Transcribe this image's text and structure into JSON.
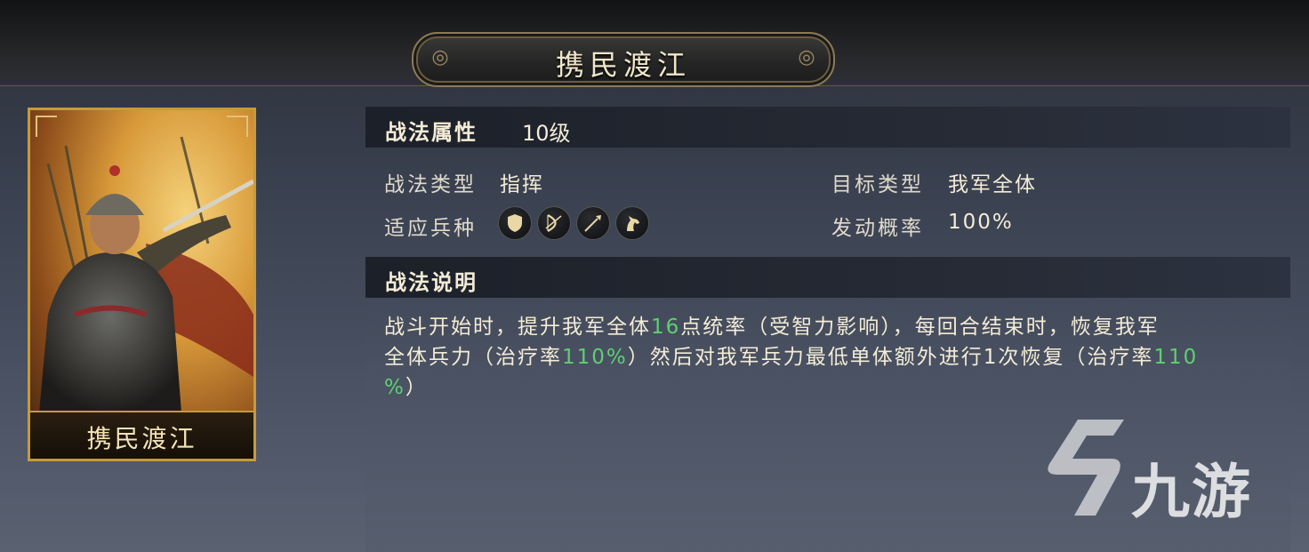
{
  "header": {
    "title": "携民渡江"
  },
  "card": {
    "name": "携民渡江"
  },
  "attributes": {
    "label": "战法属性",
    "level": "10级"
  },
  "info": {
    "tactic_type_label": "战法类型",
    "tactic_type_value": "指挥",
    "target_type_label": "目标类型",
    "target_type_value": "我军全体",
    "troop_label": "适应兵种",
    "activation_label": "发动概率",
    "activation_value": "100%",
    "troop_icons": [
      "shield-icon",
      "bow-icon",
      "spear-icon",
      "horse-icon"
    ]
  },
  "description": {
    "label": "战法说明",
    "line1_a": "战斗开始时，提升我军全体",
    "line1_hl": "16",
    "line1_b": "点统率（受智力影响），每回合结束时，恢复我军",
    "line2_a": "全体兵力（治疗率",
    "line2_hl1": "110%",
    "line2_b": "）然后对我军兵力最低单体额外进行1次恢复（治疗率",
    "line2_hl2": "110",
    "line3_hl": "%",
    "line3_b": "）"
  },
  "watermark": {
    "text": "九游"
  },
  "colors": {
    "highlight": "#5fcf72",
    "gold": "#c79a3a"
  }
}
